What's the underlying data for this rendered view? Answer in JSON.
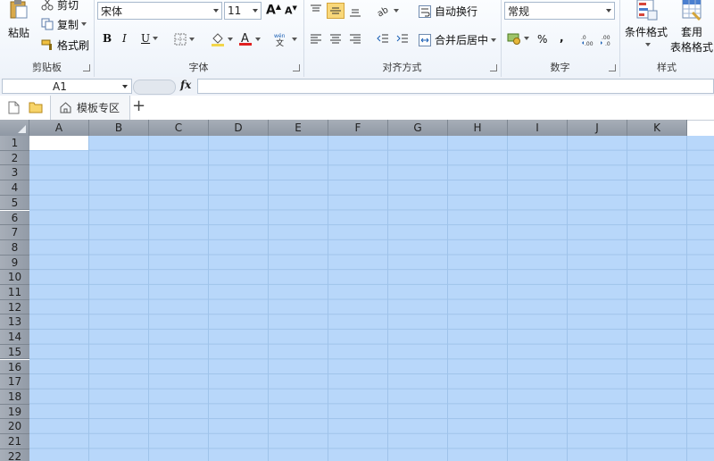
{
  "clipboard": {
    "paste": "粘贴",
    "cut": "剪切",
    "copy": "复制",
    "format_painter": "格式刷",
    "group": "剪贴板"
  },
  "font": {
    "name": "宋体",
    "size": "11",
    "bold": "B",
    "italic": "I",
    "underline": "U",
    "group": "字体",
    "fill_color": "#f2d64a",
    "font_color": "#e02020"
  },
  "alignment": {
    "wrap": "自动换行",
    "merge": "合并后居中",
    "group": "对齐方式"
  },
  "number": {
    "format": "常规",
    "percent": "%",
    "comma": ",",
    "group": "数字"
  },
  "styles": {
    "conditional": "条件格式",
    "table_format_1": "套用",
    "table_format_2": "表格格式",
    "group": "样式"
  },
  "formula_bar": {
    "name_box": "A1",
    "fx": "fx",
    "value": ""
  },
  "tabs": {
    "template": "模板专区",
    "add": "+"
  },
  "sheet": {
    "columns": [
      "A",
      "B",
      "C",
      "D",
      "E",
      "F",
      "G",
      "H",
      "I",
      "J",
      "K"
    ],
    "rows": [
      "1",
      "2",
      "3",
      "4",
      "5",
      "6",
      "7",
      "8",
      "9",
      "10",
      "11",
      "12",
      "13",
      "14",
      "15",
      "16",
      "17",
      "18",
      "19",
      "20",
      "21",
      "22"
    ],
    "active_cell": "A1",
    "selection_color": "#b8d7fa"
  }
}
